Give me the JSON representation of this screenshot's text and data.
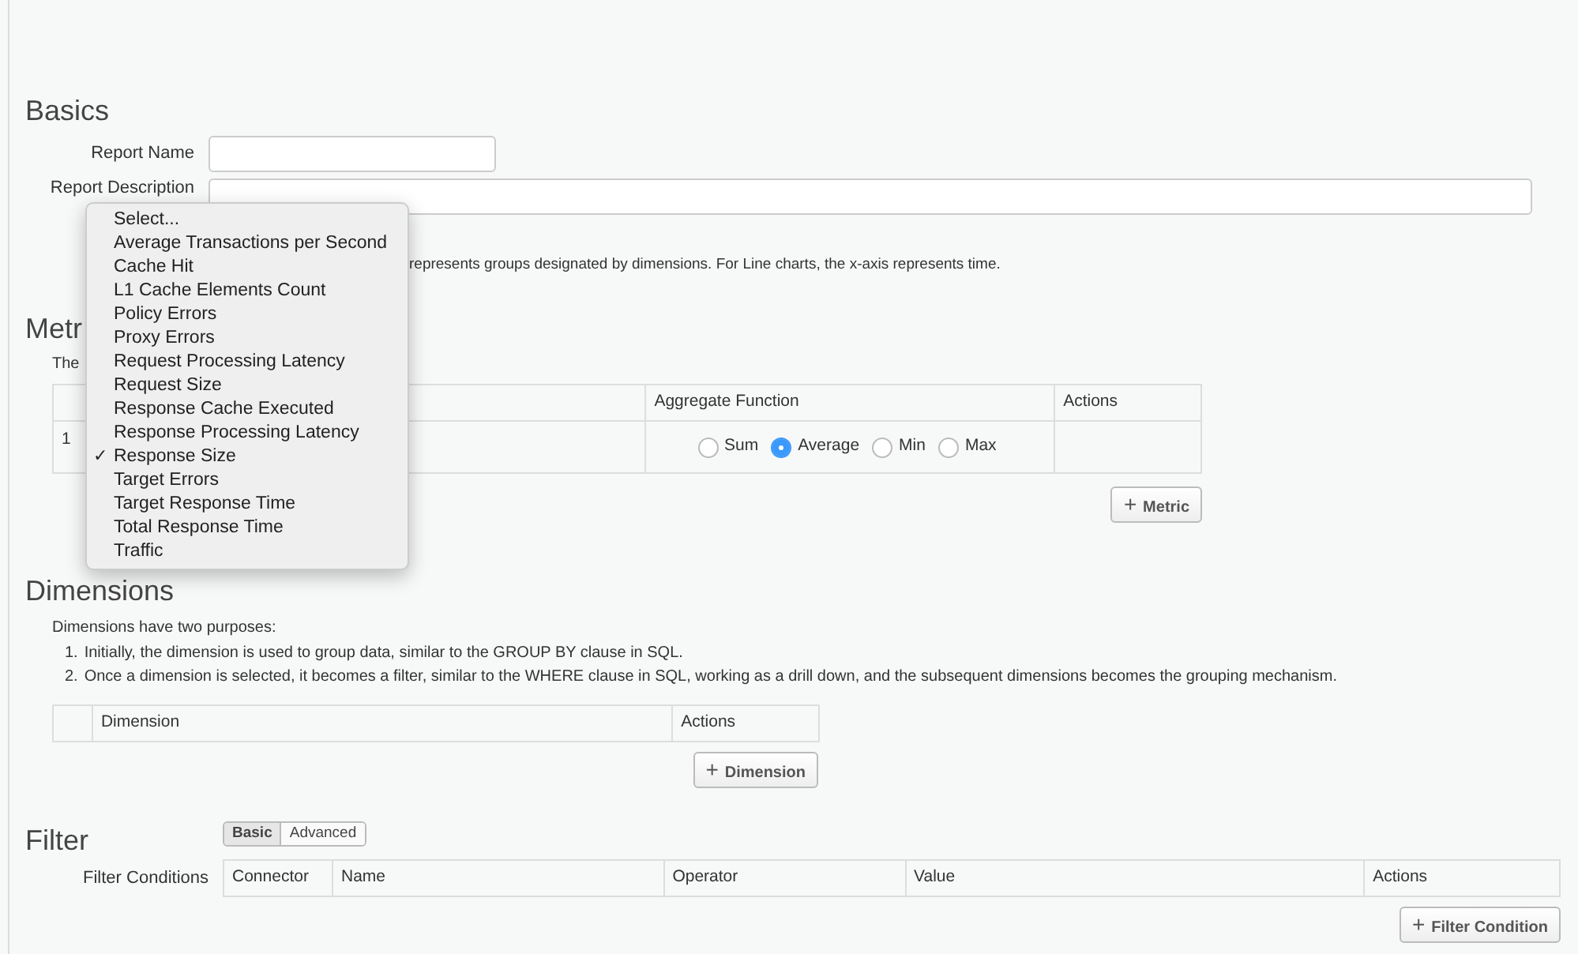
{
  "basics": {
    "heading": "Basics",
    "report_name": {
      "label": "Report Name"
    },
    "report_description": {
      "label": "Report Description"
    },
    "chart_note": "represents groups designated by dimensions. For Line charts, the x-axis represents time."
  },
  "metrics": {
    "heading": "Metr",
    "note": "The",
    "columns": [
      "",
      "",
      "Aggregate Function",
      "Actions"
    ],
    "rows": [
      {
        "index": "1",
        "aggregates": [
          {
            "label": "Sum",
            "selected": false
          },
          {
            "label": "Average",
            "selected": true
          },
          {
            "label": "Min",
            "selected": false
          },
          {
            "label": "Max",
            "selected": false
          }
        ]
      }
    ],
    "add_button": {
      "icon": "+",
      "label": "Metric"
    }
  },
  "metric_menu": [
    {
      "label": "Select...",
      "selected": false
    },
    {
      "label": "Average Transactions per Second",
      "selected": false
    },
    {
      "label": "Cache Hit",
      "selected": false
    },
    {
      "label": "L1 Cache Elements Count",
      "selected": false
    },
    {
      "label": "Policy Errors",
      "selected": false
    },
    {
      "label": "Proxy Errors",
      "selected": false
    },
    {
      "label": "Request Processing Latency",
      "selected": false
    },
    {
      "label": "Request Size",
      "selected": false
    },
    {
      "label": "Response Cache Executed",
      "selected": false
    },
    {
      "label": "Response Processing Latency",
      "selected": false
    },
    {
      "label": "Response Size",
      "selected": true
    },
    {
      "label": "Target Errors",
      "selected": false
    },
    {
      "label": "Target Response Time",
      "selected": false
    },
    {
      "label": "Total Response Time",
      "selected": false
    },
    {
      "label": "Traffic",
      "selected": false
    }
  ],
  "check_mark": "✓",
  "dimensions": {
    "heading": "Dimensions",
    "intro": "Dimensions have two purposes:",
    "points": [
      {
        "marker": "1.",
        "text": "Initially, the dimension is used to group data, similar to the GROUP BY clause in SQL."
      },
      {
        "marker": "2.",
        "text": "Once a dimension is selected, it becomes a filter, similar to the WHERE clause in SQL, working as a drill down, and the subsequent dimensions becomes the grouping mechanism."
      }
    ],
    "columns": [
      "",
      "Dimension",
      "Actions"
    ],
    "add_button": {
      "icon": "+",
      "label": "Dimension"
    }
  },
  "filter": {
    "heading": "Filter",
    "modes": [
      {
        "label": "Basic",
        "selected": true
      },
      {
        "label": "Advanced",
        "selected": false
      }
    ],
    "conditions_label": "Filter Conditions",
    "columns": [
      "Connector",
      "Name",
      "Operator",
      "Value",
      "Actions"
    ],
    "add_button": {
      "icon": "+",
      "label": "Filter Condition"
    }
  }
}
